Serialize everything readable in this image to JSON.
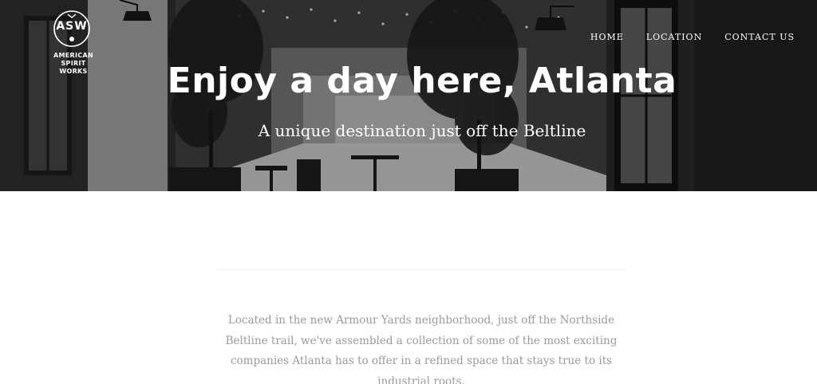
{
  "header": {
    "logo": {
      "mark": "ASW",
      "line1": "AMERICAN",
      "line2": "SPIRIT WORKS"
    },
    "nav": [
      {
        "label": "HOME"
      },
      {
        "label": "LOCATION"
      },
      {
        "label": "CONTACT US"
      }
    ]
  },
  "hero": {
    "title": "Enjoy a day here, Atlanta",
    "subtitle": "A unique destination just off the Beltline",
    "tone": "grayscale"
  },
  "main": {
    "intro": "Located in the new Armour Yards neighborhood, just off the Northside Beltline trail, we've assembled a collection of some of the most exciting companies Atlanta has to offer in a refined space that stays true to its industrial roots."
  },
  "colors": {
    "text_light": "#ffffff",
    "body_text": "#9a9a9a",
    "divider": "#ececec",
    "hero_dark": "#2e2e2e"
  }
}
